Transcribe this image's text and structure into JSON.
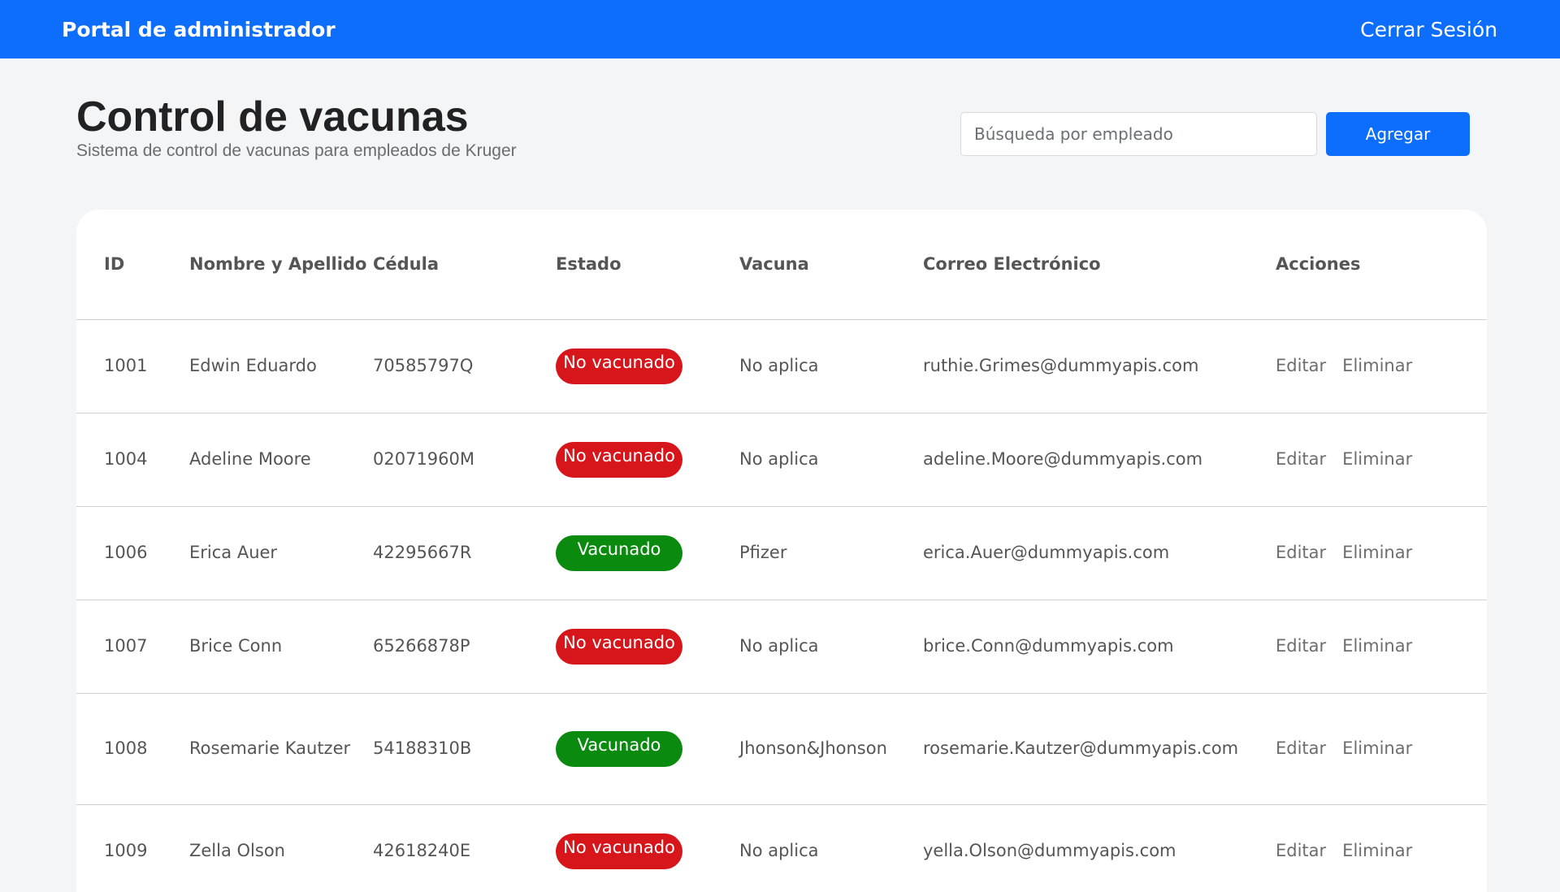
{
  "topbar": {
    "brand": "Portal de administrador",
    "logout_label": "Cerrar Sesión"
  },
  "header": {
    "title": "Control de vacunas",
    "subtitle": "Sistema de control de vacunas para empleados de Kruger",
    "search_placeholder": "Búsqueda por empleado",
    "add_label": "Agregar"
  },
  "colors": {
    "primary": "#0d6efd",
    "status_no": "#d7161b",
    "status_yes": "#0a8a0f"
  },
  "table": {
    "columns": {
      "id": "ID",
      "name": "Nombre y Apellido",
      "cedula": "Cédula",
      "estado": "Estado",
      "vacuna": "Vacuna",
      "correo": "Correo Electrónico",
      "acciones": "Acciones"
    },
    "action_edit": "Editar",
    "action_delete": "Eliminar",
    "rows": [
      {
        "id": "1001",
        "name": "Edwin Eduardo",
        "cedula": "70585797Q",
        "estado": "No vacunado",
        "vaccinated": false,
        "vacuna": "No aplica",
        "correo": "ruthie.Grimes@dummyapis.com"
      },
      {
        "id": "1004",
        "name": "Adeline Moore",
        "cedula": "02071960M",
        "estado": "No vacunado",
        "vaccinated": false,
        "vacuna": "No aplica",
        "correo": "adeline.Moore@dummyapis.com"
      },
      {
        "id": "1006",
        "name": "Erica Auer",
        "cedula": "42295667R",
        "estado": "Vacunado",
        "vaccinated": true,
        "vacuna": "Pfizer",
        "correo": "erica.Auer@dummyapis.com"
      },
      {
        "id": "1007",
        "name": "Brice Conn",
        "cedula": "65266878P",
        "estado": "No vacunado",
        "vaccinated": false,
        "vacuna": "No aplica",
        "correo": "brice.Conn@dummyapis.com"
      },
      {
        "id": "1008",
        "name": "Rosemarie Kautzer",
        "cedula": "54188310B",
        "estado": "Vacunado",
        "vaccinated": true,
        "vacuna": "Jhonson&Jhonson",
        "correo": "rosemarie.Kautzer@dummyapis.com"
      },
      {
        "id": "1009",
        "name": "Zella Olson",
        "cedula": "42618240E",
        "estado": "No vacunado",
        "vaccinated": false,
        "vacuna": "No aplica",
        "correo": "yella.Olson@dummyapis.com"
      }
    ]
  }
}
